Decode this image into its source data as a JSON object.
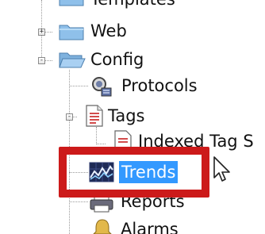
{
  "tree": {
    "items": [
      {
        "label": "Templates",
        "icon": "folder-icon"
      },
      {
        "label": "Web",
        "icon": "folder-icon",
        "expander": "+"
      },
      {
        "label": "Config",
        "icon": "folder-open-icon",
        "expander": "-"
      },
      {
        "label": "Protocols",
        "icon": "protocols-icon"
      },
      {
        "label": "Tags",
        "icon": "tags-icon",
        "expander": "-"
      },
      {
        "label": "Indexed Tag S",
        "icon": "indexed-tag-icon"
      },
      {
        "label": "Trends",
        "icon": "trends-icon",
        "selected": true
      },
      {
        "label": "Reports",
        "icon": "reports-icon"
      },
      {
        "label": "Alarms",
        "icon": "alarms-icon"
      }
    ]
  },
  "annotation": {
    "color": "#cc1a1a"
  },
  "colors": {
    "selection": "#3399ff",
    "folder": "#6fa8dc"
  }
}
